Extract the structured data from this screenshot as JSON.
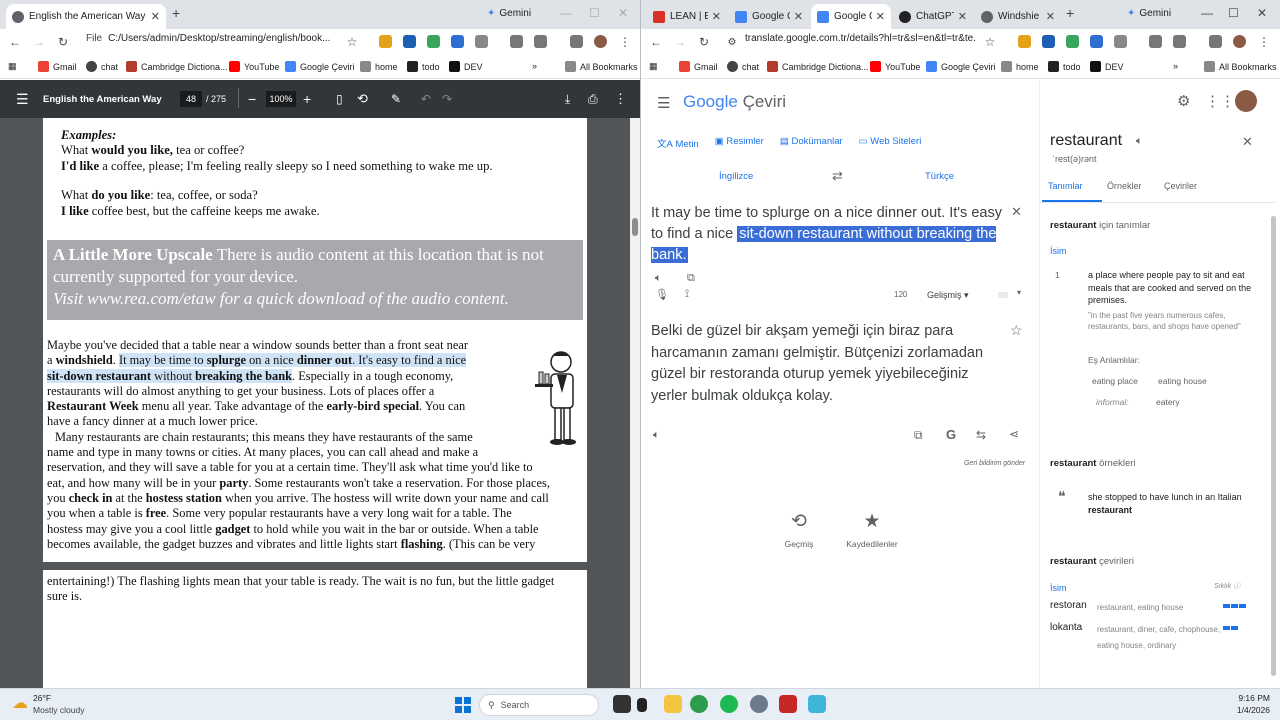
{
  "left_window": {
    "tabs": [
      {
        "label": "English the American Way",
        "active": true
      }
    ],
    "gemini_label": "Gemini",
    "address": "C:/Users/admin/Desktop/streaming/english/book...",
    "file_chip": "File",
    "bookmarks": [
      "Gmail",
      "chat",
      "Cambridge Dictiona...",
      "YouTube",
      "Google Çeviri",
      "home",
      "todo",
      "DEV"
    ],
    "all_bookmarks": "All Bookmarks",
    "pdf": {
      "title": "English the American Way",
      "page": "48",
      "total": "/ 275",
      "zoom": "100%",
      "examples_head": "Examples:",
      "ex1_a": "What ",
      "ex1_b": "would you like,",
      "ex1_c": " tea or coffee?",
      "ex2_a": "I'd like",
      "ex2_b": " a coffee, please; I'm feeling really sleepy so I need something to wake me up.",
      "ex3_a": "What ",
      "ex3_b": "do you like",
      "ex3_c": ": tea, coffee, or soda?",
      "ex4_a": "I ",
      "ex4_b": "like",
      "ex4_c": " coffee best, but the caffeine keeps me awake.",
      "box_title": "A Little More Upscale",
      "box_text": "There is audio content at this location that is not currently supported for your device.",
      "box_visit": "Visit www.rea.com/etaw for a quick download of the audio content.",
      "p1_l1": "Maybe you've decided that a table near a window sounds better than a front seat near",
      "p1_l2a": "a ",
      "p1_l2b": "windshield",
      ". ": "",
      "p1_l2c": ". ",
      "p1_l2d": "It may be time to ",
      "p1_l2e": "splurge",
      "p1_l2f": " on a nice ",
      "p1_l2g": "dinner out",
      ". It's": "",
      "p1_l2h": ". It's easy to find a nice",
      "p1_l3a": "sit-down restaurant",
      "p1_l3b": " without ",
      "p1_l3c": "breaking the bank",
      "p1_l3d": ". Especially in a tough economy,",
      "p1_l4": "restaurants will do almost anything to get your business. Lots of places offer a",
      "p1_l5a": "Restaurant Week",
      "p1_l5b": " menu all year. Take advantage of the ",
      "p1_l5c": "early-bird special",
      "p1_l5d": ". You can",
      "p1_l6": "have a fancy dinner at a much lower price.",
      "p2_l1": "Many restaurants are chain restaurants; this means they have restaurants of the same",
      "p2_l2": "name and type in many towns or cities. At many places, you can call ahead and make a",
      "p2_l3": "reservation, and they will save a table for you at a certain time. They'll ask what time you'd like to",
      "p2_l4a": "eat, and how many will be in your ",
      "p2_l4b": "party",
      "p2_l4c": ". Some restaurants won't take a reservation. For those places,",
      "p2_l5a": "you ",
      "p2_l5b": "check in",
      "p2_l5c": " at the ",
      "p2_l5d": "hostess station",
      "p2_l5e": " when you arrive. The hostess will write down your name and call",
      "p2_l6a": "you when a table is ",
      "p2_l6b": "free",
      "p2_l6c": ". Some very popular restaurants have a very long wait for a table. The",
      "p2_l7a": "hostess may give you a cool little ",
      "p2_l7b": "gadget",
      "p2_l7c": " to hold while you wait in the bar or outside. When a table",
      "p2_l8a": "becomes available, the gadget buzzes and vibrates and little lights start ",
      "p2_l8b": "flashing",
      "p2_l8c": ". (This can be very",
      "p3_l1": "entertaining!) The flashing lights mean that your table is ready. The wait is no fun, but the little gadget",
      "p3_l2": "sure is."
    }
  },
  "right_window": {
    "tabs": [
      "LEAN | En",
      "Google Ç",
      "Google Ç",
      "ChatGPT",
      "Windshie"
    ],
    "gemini_label": "Gemini",
    "address": "translate.google.com.tr/details?hl=tr&sl=en&tl=tr&te...",
    "bookmarks": [
      "Gmail",
      "chat",
      "Cambridge Dictiona...",
      "YouTube",
      "Google Çeviri",
      "home",
      "todo",
      "DEV"
    ],
    "all_bookmarks": "All Bookmarks",
    "translate": {
      "logo_google": "Google",
      "logo_ceviri": "Çeviri",
      "modes": [
        "Metin",
        "Resimler",
        "Dokümanlar",
        "Web Siteleri"
      ],
      "src_lang": "İngilizce",
      "tgt_lang": "Türkçe",
      "src_text_1": "It may be time to splurge on a nice dinner out. It's easy to find a nice",
      "src_text_sel": "sit-down restaurant without breaking the bank.",
      "char_count": "120",
      "advanced": "Gelişmiş",
      "tgt_text": "Belki de güzel bir akşam yemeği için biraz para harcamanın zamanı gelmiştir. Bütçenizi zorlamadan güzel bir restoranda oturup yemek yiyebileceğiniz yerler bulmak oldukça kolay.",
      "feedback": "Geri bildirim gönder",
      "history": "Geçmiş",
      "saved": "Kaydedilenler",
      "dict": {
        "word": "restaurant",
        "phonetic": "ˈrest(ə)rənt",
        "tabs": [
          "Tanımlar",
          "Örnekler",
          "Çeviriler"
        ],
        "def_head_a": "restaurant",
        "def_head_b": " için tanımlar",
        "pos": "İsim",
        "def_num": "1",
        "def_text": "a place where people pay to sit and eat meals that are cooked and served on the premises.",
        "def_example": "\"in the past five years numerous cafes, restaurants, bars, and shops have opened\"",
        "syn_label": "Eş Anlamlılar:",
        "syns": [
          "eating place",
          "eating house"
        ],
        "informal_label": "informal:",
        "informal_syn": "eatery",
        "ex_head_a": "restaurant",
        "ex_head_b": " örnekleri",
        "ex_text_a": "she stopped to have lunch in an Italian ",
        "ex_text_b": "restaurant",
        "tr_head_a": "restaurant",
        "tr_head_b": " çevirileri",
        "tr_pos": "İsim",
        "tr_freq": "Sıklık",
        "translations": [
          {
            "word": "restoran",
            "backs": "restaurant, eating house",
            "freq": 3
          },
          {
            "word": "lokanta",
            "backs": "restaurant, diner, cafe, chophouse, eating house, ordinary",
            "freq": 2
          }
        ]
      }
    }
  },
  "taskbar": {
    "temp": "26°F",
    "weather": "Mostly cloudy",
    "search": "Search",
    "time": "9:16 PM",
    "date": "1/4/2026"
  }
}
